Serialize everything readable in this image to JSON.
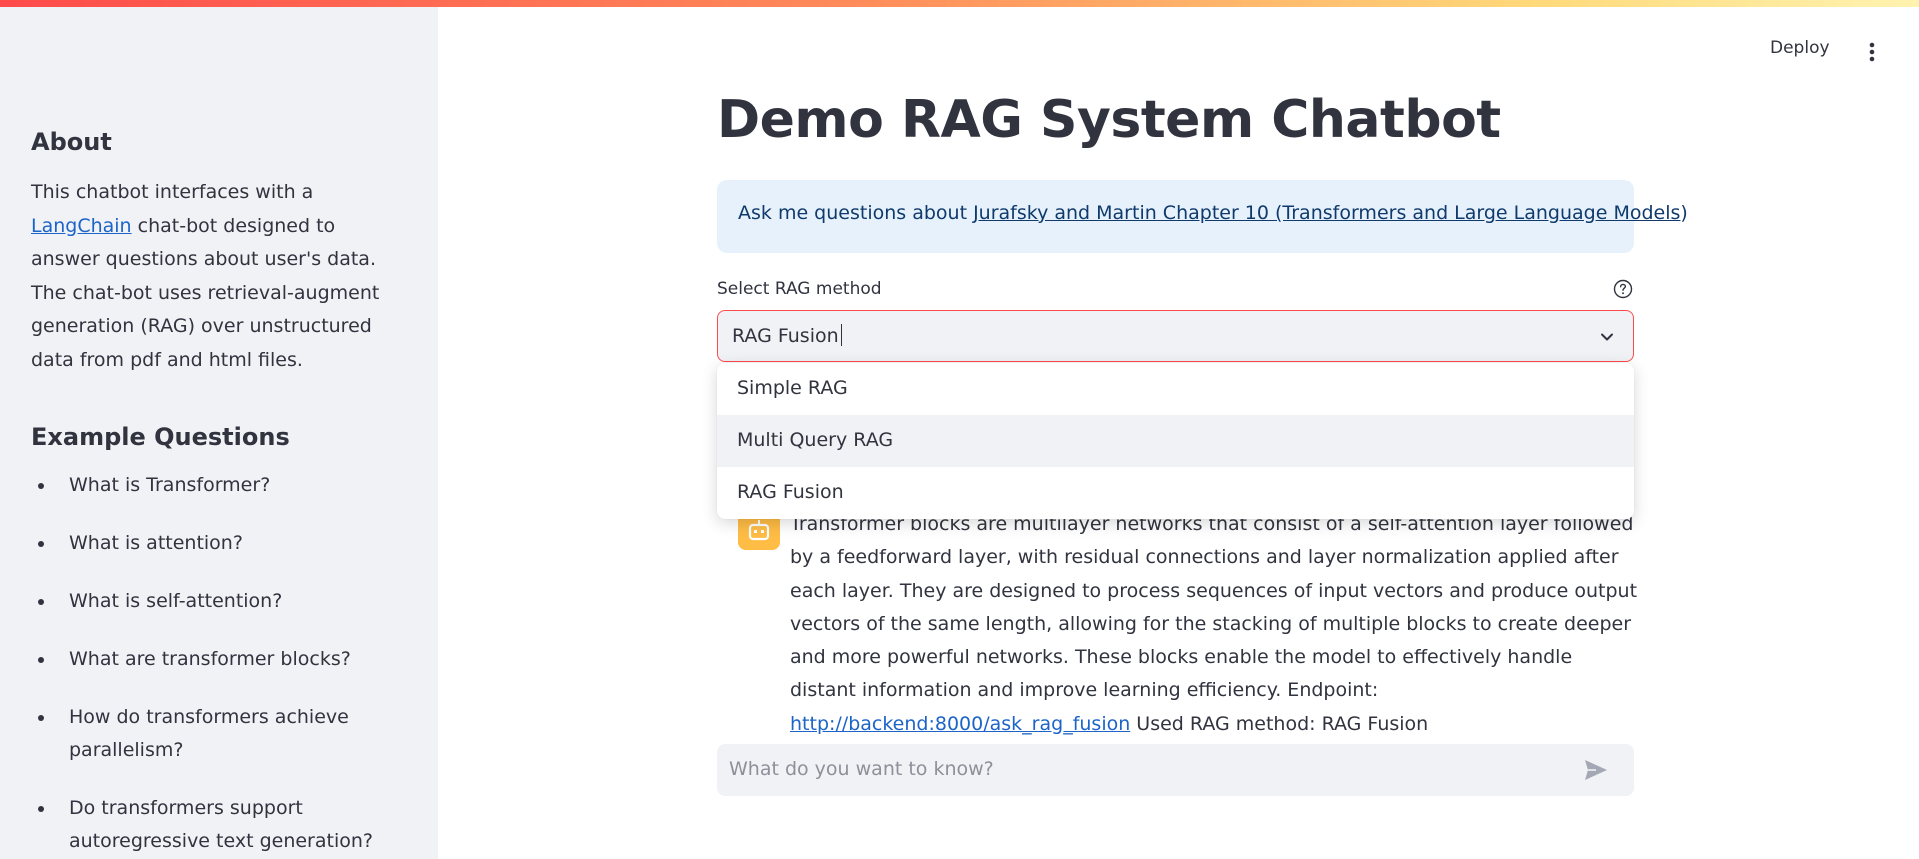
{
  "header": {
    "deploy_label": "Deploy",
    "menu_icon": "kebab-menu-icon",
    "top_bar_colors": [
      "#ff4b4b",
      "#ffd97a"
    ]
  },
  "sidebar": {
    "about_title": "About",
    "about_text_before": "This chatbot interfaces with a ",
    "about_link": "LangChain",
    "about_text_after": " chat-bot designed to answer questions about user's data. The chat-bot uses retrieval-augment generation (RAG) over unstructured data from pdf and html files.",
    "examples_title": "Example Questions",
    "examples": [
      "What is Transformer?",
      "What is attention?",
      "What is self-attention?",
      "What are transformer blocks?",
      "How do transformers achieve parallelism?",
      "Do transformers support autoregressive text generation?"
    ]
  },
  "main": {
    "title": "Demo RAG System Chatbot",
    "info_prefix": "Ask me questions about ",
    "info_link": "Jurafsky and Martin Chapter 10 (Transformers and Large Language Models",
    "info_suffix": ")",
    "select": {
      "label": "Select RAG method",
      "value": "RAG Fusion",
      "help_icon": "question-circle-icon",
      "options": [
        "Simple RAG",
        "Multi Query RAG",
        "RAG Fusion"
      ],
      "hovered_option": "Multi Query RAG"
    },
    "message": {
      "avatar_icon": "robot-icon",
      "avatar_color": "#ffbd45",
      "text": "Transformer blocks are multilayer networks that consist of a self-attention layer followed by a feedforward layer, with residual connections and layer normalization applied after each layer. They are designed to process sequences of input vectors and produce output vectors of the same length, allowing for the stacking of multiple blocks to create deeper and more powerful networks. These blocks enable the model to effectively handle distant information and improve learning efficiency. Endpoint: ",
      "endpoint_link": "http://backend:8000/ask_rag_fusion",
      "method_text": " Used RAG method: RAG Fusion"
    },
    "chat_input": {
      "placeholder": "What do you want to know?",
      "send_icon": "send-icon"
    }
  },
  "colors": {
    "accent": "#ff4b4b",
    "link": "#1c64c8",
    "info_bg": "#e6f1fc",
    "sidebar_bg": "#f0f2f6"
  }
}
